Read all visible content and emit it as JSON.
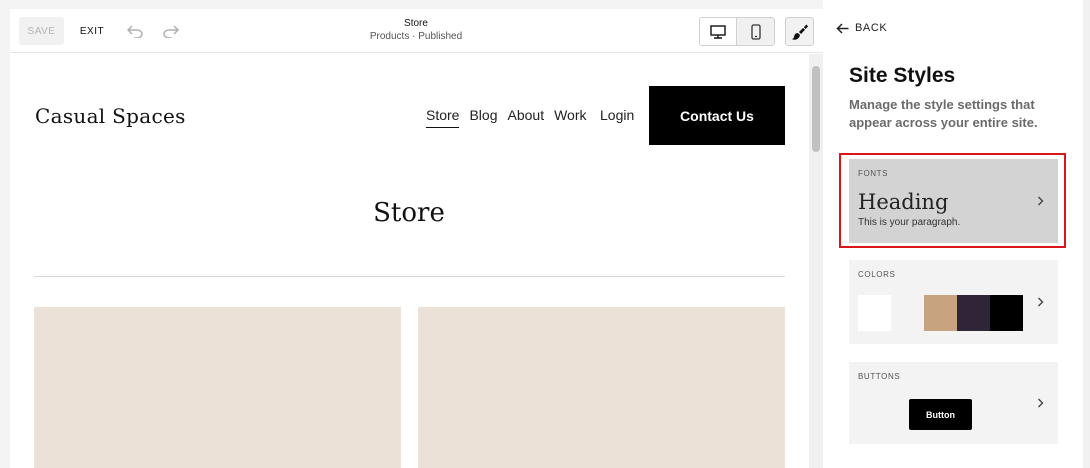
{
  "toolbar": {
    "save_label": "SAVE",
    "exit_label": "EXIT",
    "page_title": "Store",
    "page_subtitle": "Products · Published"
  },
  "site": {
    "logo": "Casual Spaces",
    "nav": [
      {
        "label": "Store",
        "active": true
      },
      {
        "label": "Blog",
        "active": false
      },
      {
        "label": "About",
        "active": false
      },
      {
        "label": "Work",
        "active": false
      }
    ],
    "login_label": "Login",
    "cta_label": "Contact Us",
    "page_heading": "Store"
  },
  "panel": {
    "back_label": "BACK",
    "title": "Site Styles",
    "description": "Manage the style settings that appear across your entire site.",
    "fonts": {
      "label": "FONTS",
      "heading_sample": "Heading",
      "paragraph_sample": "This is your paragraph."
    },
    "colors": {
      "label": "COLORS",
      "swatches": [
        "#ffffff",
        "#f3f3f3",
        "#c8a37f",
        "#302538",
        "#000000"
      ]
    },
    "buttons": {
      "label": "BUTTONS",
      "sample_label": "Button"
    }
  },
  "colors": {
    "highlight_outline": "#d9161b",
    "product_placeholder": "#ebe1d7"
  }
}
